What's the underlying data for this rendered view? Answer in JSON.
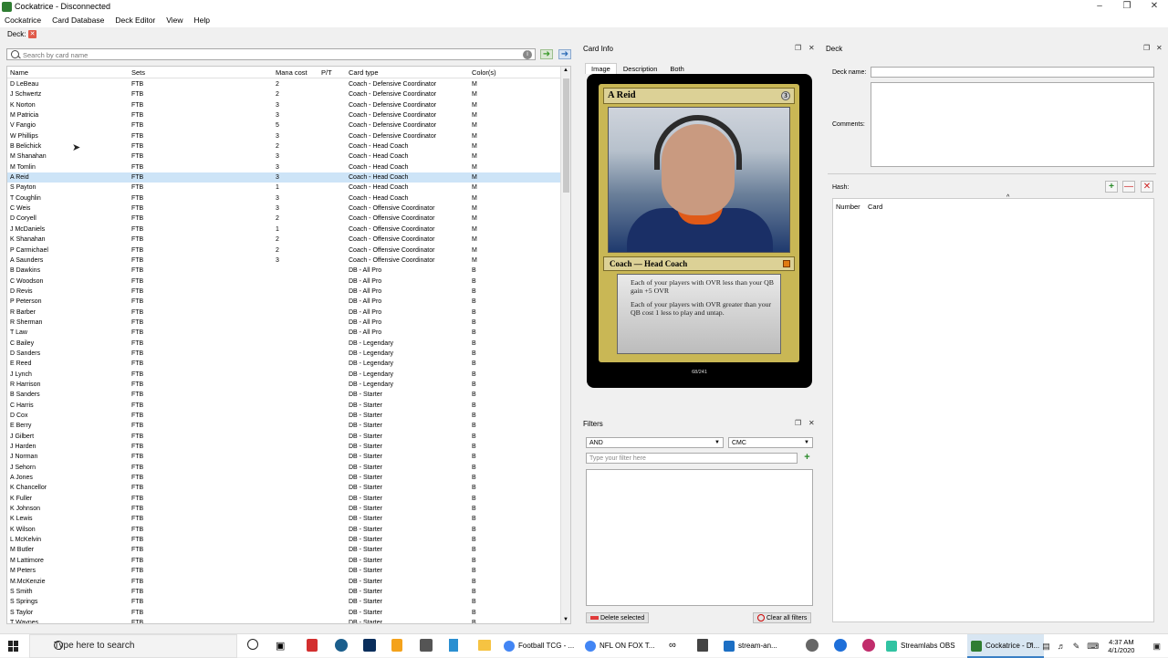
{
  "window": {
    "title": "Cockatrice - Disconnected"
  },
  "menubar": [
    "Cockatrice",
    "Card Database",
    "Deck Editor",
    "View",
    "Help"
  ],
  "tab": {
    "label": "Deck:"
  },
  "search": {
    "placeholder": "Search by card name"
  },
  "table": {
    "headers": [
      "Name",
      "Sets",
      "Mana cost",
      "P/T",
      "Card type",
      "Color(s)"
    ],
    "rows": [
      [
        "D LeBeau",
        "FTB",
        "2",
        "",
        "Coach - Defensive Coordinator",
        "M"
      ],
      [
        "J Schwertz",
        "FTB",
        "2",
        "",
        "Coach - Defensive Coordinator",
        "M"
      ],
      [
        "K Norton",
        "FTB",
        "3",
        "",
        "Coach - Defensive Coordinator",
        "M"
      ],
      [
        "M Patricia",
        "FTB",
        "3",
        "",
        "Coach - Defensive Coordinator",
        "M"
      ],
      [
        "V Fangio",
        "FTB",
        "5",
        "",
        "Coach - Defensive Coordinator",
        "M"
      ],
      [
        "W Phillips",
        "FTB",
        "3",
        "",
        "Coach - Defensive Coordinator",
        "M"
      ],
      [
        "B Belichick",
        "FTB",
        "2",
        "",
        "Coach - Head Coach",
        "M"
      ],
      [
        "M Shanahan",
        "FTB",
        "3",
        "",
        "Coach - Head Coach",
        "M"
      ],
      [
        "M Tomlin",
        "FTB",
        "3",
        "",
        "Coach - Head Coach",
        "M"
      ],
      [
        "A Reid",
        "FTB",
        "3",
        "",
        "Coach - Head Coach",
        "M"
      ],
      [
        "S Payton",
        "FTB",
        "1",
        "",
        "Coach - Head Coach",
        "M"
      ],
      [
        "T Coughlin",
        "FTB",
        "3",
        "",
        "Coach - Head Coach",
        "M"
      ],
      [
        "C Weis",
        "FTB",
        "3",
        "",
        "Coach - Offensive Coordinator",
        "M"
      ],
      [
        "D Coryell",
        "FTB",
        "2",
        "",
        "Coach - Offensive Coordinator",
        "M"
      ],
      [
        "J McDaniels",
        "FTB",
        "1",
        "",
        "Coach - Offensive Coordinator",
        "M"
      ],
      [
        "K Shanahan",
        "FTB",
        "2",
        "",
        "Coach - Offensive Coordinator",
        "M"
      ],
      [
        "P Carmichael",
        "FTB",
        "2",
        "",
        "Coach - Offensive Coordinator",
        "M"
      ],
      [
        "A Saunders",
        "FTB",
        "3",
        "",
        "Coach - Offensive Coordinator",
        "M"
      ],
      [
        "B Dawkins",
        "FTB",
        "",
        "",
        "DB - All Pro",
        "B"
      ],
      [
        "C Woodson",
        "FTB",
        "",
        "",
        "DB - All Pro",
        "B"
      ],
      [
        "D Revis",
        "FTB",
        "",
        "",
        "DB - All Pro",
        "B"
      ],
      [
        "P Peterson",
        "FTB",
        "",
        "",
        "DB - All Pro",
        "B"
      ],
      [
        "R Barber",
        "FTB",
        "",
        "",
        "DB - All Pro",
        "B"
      ],
      [
        "R Sherman",
        "FTB",
        "",
        "",
        "DB - All Pro",
        "B"
      ],
      [
        "T Law",
        "FTB",
        "",
        "",
        "DB - All Pro",
        "B"
      ],
      [
        "C Bailey",
        "FTB",
        "",
        "",
        "DB - Legendary",
        "B"
      ],
      [
        "D Sanders",
        "FTB",
        "",
        "",
        "DB - Legendary",
        "B"
      ],
      [
        "E Reed",
        "FTB",
        "",
        "",
        "DB - Legendary",
        "B"
      ],
      [
        "J Lynch",
        "FTB",
        "",
        "",
        "DB - Legendary",
        "B"
      ],
      [
        "R Harrison",
        "FTB",
        "",
        "",
        "DB - Legendary",
        "B"
      ],
      [
        "B Sanders",
        "FTB",
        "",
        "",
        "DB - Starter",
        "B"
      ],
      [
        "C Harris",
        "FTB",
        "",
        "",
        "DB - Starter",
        "B"
      ],
      [
        "D Cox",
        "FTB",
        "",
        "",
        "DB - Starter",
        "B"
      ],
      [
        "E Berry",
        "FTB",
        "",
        "",
        "DB - Starter",
        "B"
      ],
      [
        "J Gilbert",
        "FTB",
        "",
        "",
        "DB - Starter",
        "B"
      ],
      [
        "J Harden",
        "FTB",
        "",
        "",
        "DB - Starter",
        "B"
      ],
      [
        "J Norman",
        "FTB",
        "",
        "",
        "DB - Starter",
        "B"
      ],
      [
        "J Sehorn",
        "FTB",
        "",
        "",
        "DB - Starter",
        "B"
      ],
      [
        "A Jones",
        "FTB",
        "",
        "",
        "DB - Starter",
        "B"
      ],
      [
        "K Chancellor",
        "FTB",
        "",
        "",
        "DB - Starter",
        "B"
      ],
      [
        "K Fuller",
        "FTB",
        "",
        "",
        "DB - Starter",
        "B"
      ],
      [
        "K Johnson",
        "FTB",
        "",
        "",
        "DB - Starter",
        "B"
      ],
      [
        "K Lewis",
        "FTB",
        "",
        "",
        "DB - Starter",
        "B"
      ],
      [
        "K Wilson",
        "FTB",
        "",
        "",
        "DB - Starter",
        "B"
      ],
      [
        "L McKelvin",
        "FTB",
        "",
        "",
        "DB - Starter",
        "B"
      ],
      [
        "M Butler",
        "FTB",
        "",
        "",
        "DB - Starter",
        "B"
      ],
      [
        "M Lattimore",
        "FTB",
        "",
        "",
        "DB - Starter",
        "B"
      ],
      [
        "M Peters",
        "FTB",
        "",
        "",
        "DB - Starter",
        "B"
      ],
      [
        "M.McKenzie",
        "FTB",
        "",
        "",
        "DB - Starter",
        "B"
      ],
      [
        "S Smith",
        "FTB",
        "",
        "",
        "DB - Starter",
        "B"
      ],
      [
        "S Springs",
        "FTB",
        "",
        "",
        "DB - Starter",
        "B"
      ],
      [
        "S Taylor",
        "FTB",
        "",
        "",
        "DB - Starter",
        "B"
      ],
      [
        "T Waynes",
        "FTB",
        "",
        "",
        "DB - Starter",
        "B"
      ]
    ],
    "selected_row": "A Reid"
  },
  "card_info": {
    "panel_title": "Card Info",
    "subtabs": [
      "Image",
      "Description",
      "Both"
    ],
    "card_name": "A Reid",
    "cost": "3",
    "type_line": "Coach — Head Coach",
    "text1": "Each of your players with OVR less than your QB gain +5 OVR",
    "text2": "Each of your players with OVR greater than your QB cost 1 less to play and untap.",
    "number": "68/241"
  },
  "filters": {
    "panel_title": "Filters",
    "logic": "AND",
    "field": "CMC",
    "input_placeholder": "Type your filter here",
    "delete_label": "Delete selected",
    "clear_label": "Clear all filters"
  },
  "deck": {
    "panel_title": "Deck",
    "name_label": "Deck name:",
    "comments_label": "Comments:",
    "hash_label": "Hash:",
    "col_number": "Number",
    "col_card": "Card"
  },
  "taskbar": {
    "search_placeholder": "Type here to search",
    "apps": [
      "Football TCG - ...",
      "NFL ON FOX T...",
      "stream-an...",
      "Streamlabs OBS",
      "Cockatrice - Di..."
    ],
    "time": "4:37 AM",
    "date": "4/1/2020"
  }
}
